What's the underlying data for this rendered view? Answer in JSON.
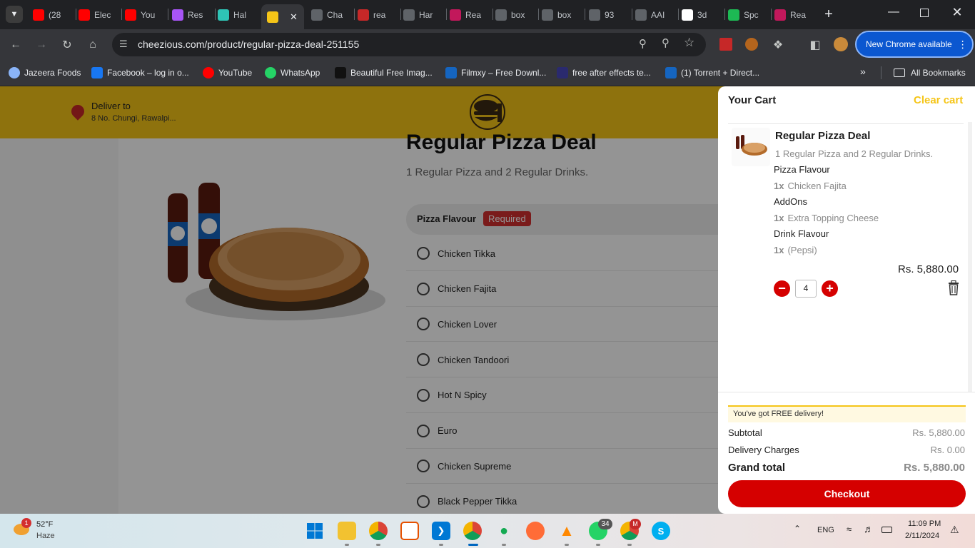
{
  "browser": {
    "tabs": [
      {
        "label": "(28",
        "icon": "youtube-icon",
        "color": "#ff0000"
      },
      {
        "label": "Elec",
        "icon": "youtube-icon",
        "color": "#ff0000"
      },
      {
        "label": "You",
        "icon": "youtube-icon",
        "color": "#ff0000"
      },
      {
        "label": "Res",
        "icon": "vite-icon",
        "color": "#a855f7"
      },
      {
        "label": "Hal",
        "icon": "wave-icon",
        "color": "#2ec4b6"
      },
      {
        "label": "",
        "icon": "cheezious-icon",
        "color": "#f5c518"
      },
      {
        "label": "Cha",
        "icon": "openai-icon",
        "color": "#5f6368"
      },
      {
        "label": "rea",
        "icon": "bookmark-red-icon",
        "color": "#c62828"
      },
      {
        "label": "Har",
        "icon": "openai-icon",
        "color": "#5f6368"
      },
      {
        "label": "Rea",
        "icon": "react-icon",
        "color": "#c2185b"
      },
      {
        "label": "box",
        "icon": "google-icon",
        "color": "#5f6368"
      },
      {
        "label": "box",
        "icon": "medium-icon",
        "color": "#5f6368"
      },
      {
        "label": "93",
        "icon": "x-icon",
        "color": "#5f6368"
      },
      {
        "label": "AAI",
        "icon": "google-icon",
        "color": "#5f6368"
      },
      {
        "label": "3d",
        "icon": "google-g-icon",
        "color": "#ffffff"
      },
      {
        "label": "Spc",
        "icon": "spotify-green-icon",
        "color": "#1db954"
      },
      {
        "label": "Rea",
        "icon": "react-icon",
        "color": "#c2185b"
      }
    ],
    "url": "cheezious.com/product/regular-pizza-deal-251155",
    "new_chrome_label": "New Chrome available",
    "bookmarks": [
      {
        "label": "Jazeera Foods",
        "icon": "globe-icon"
      },
      {
        "label": "Facebook – log in o...",
        "icon": "facebook-icon"
      },
      {
        "label": "YouTube",
        "icon": "youtube-icon"
      },
      {
        "label": "WhatsApp",
        "icon": "whatsapp-icon"
      },
      {
        "label": "Beautiful Free Imag...",
        "icon": "unsplash-icon"
      },
      {
        "label": "Filmxy – Free Downl...",
        "icon": "filmxy-icon"
      },
      {
        "label": "free after effects te...",
        "icon": "ae-icon"
      },
      {
        "label": "(1) Torrent + Direct...",
        "icon": "torrent-icon"
      }
    ],
    "all_bookmarks_label": "All Bookmarks"
  },
  "site": {
    "deliver_to_label": "Deliver to",
    "deliver_address": "8 No. Chungi, Rawalpi...",
    "product_title": "Regular Pizza Deal",
    "product_subtitle": "1 Regular Pizza and 2 Regular Drinks.",
    "section_title": "Pizza Flavour",
    "required_label": "Required",
    "flavours": [
      "Chicken Tikka",
      "Chicken Fajita",
      "Chicken Lover",
      "Chicken Tandoori",
      "Hot N Spicy",
      "Euro",
      "Chicken Supreme",
      "Black Pepper Tikka"
    ]
  },
  "cart": {
    "title": "Your Cart",
    "clear_label": "Clear cart",
    "item_name": "Regular Pizza Deal",
    "item_desc": "1 Regular Pizza and 2 Regular Drinks.",
    "options": [
      {
        "group": "Pizza Flavour",
        "qty": "1x",
        "value": "Chicken Fajita"
      },
      {
        "group": "AddOns",
        "qty": "1x",
        "value": "Extra Topping Cheese"
      },
      {
        "group": "Drink Flavour",
        "qty": "1x",
        "value": "(Pepsi)"
      }
    ],
    "item_price": "Rs. 5,880.00",
    "quantity": "4",
    "free_delivery_msg": "You've got FREE delivery!",
    "subtotal_label": "Subtotal",
    "subtotal_value": "Rs. 5,880.00",
    "delivery_label": "Delivery Charges",
    "delivery_value": "Rs. 0.00",
    "grand_label": "Grand total",
    "grand_value": "Rs. 5,880.00",
    "checkout_label": "Checkout",
    "accent": "#d50000",
    "clear_color": "#f5c518"
  },
  "taskbar": {
    "weather_temp": "52°F",
    "weather_desc": "Haze",
    "weather_badge": "1",
    "lang": "ENG",
    "time": "11:09 PM",
    "date": "2/11/2024",
    "whatsapp_badge": "34",
    "gmail_badge": "M"
  }
}
